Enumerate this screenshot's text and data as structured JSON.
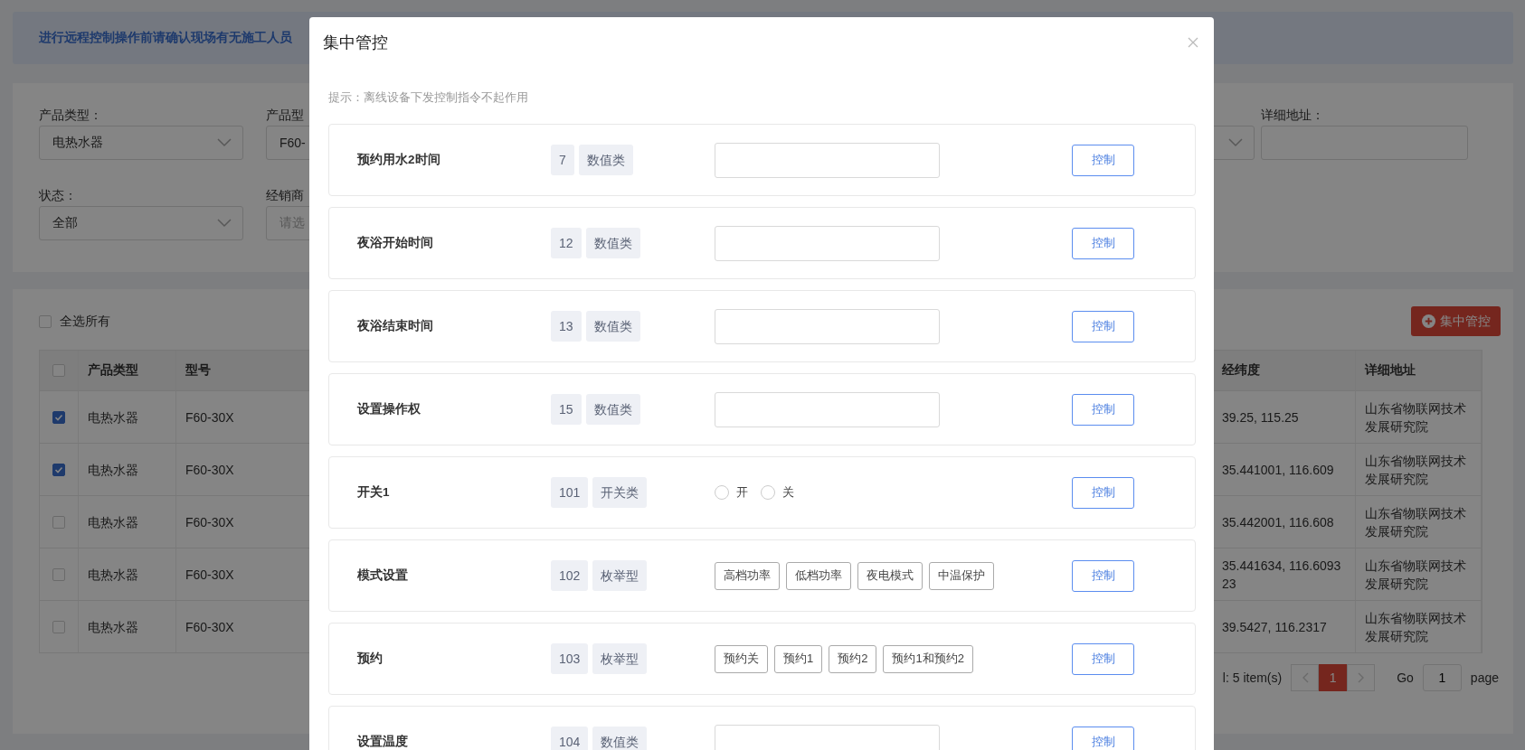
{
  "banner": {
    "text": "进行远程控制操作前请确认现场有无施工人员"
  },
  "filters": {
    "product_type": {
      "label": "产品类型：",
      "value": "电热水器"
    },
    "product_model": {
      "label": "产品型",
      "value": "F60-"
    },
    "address": {
      "label": "详细地址："
    },
    "status": {
      "label": "状态：",
      "value": "全部"
    },
    "dealer": {
      "label": "经销商",
      "placeholder": "请选"
    }
  },
  "table": {
    "select_all": {
      "label": "全选所有",
      "checked": false
    },
    "batch_button": "集中管控",
    "header_checked": false,
    "columns": [
      "产品类型",
      "型号",
      "经纬度",
      "详细地址"
    ],
    "rows": [
      {
        "checked": true,
        "type": "电热水器",
        "model": "F60-30X",
        "coords": "39.25, 115.25",
        "address": "山东省物联网技术发展研究院"
      },
      {
        "checked": true,
        "type": "电热水器",
        "model": "F60-30X",
        "coords": "35.441001, 116.609",
        "address": "山东省物联网技术发展研究院"
      },
      {
        "checked": false,
        "type": "电热水器",
        "model": "F60-30X",
        "coords": "35.442001, 116.608",
        "address": "山东省物联网技术发展研究院"
      },
      {
        "checked": false,
        "type": "电热水器",
        "model": "F60-30X",
        "coords": "35.441634, 116.609323",
        "address": "山东省物联网技术发展研究院"
      },
      {
        "checked": false,
        "type": "电热水器",
        "model": "F60-30X",
        "coords": "39.5427, 116.2317",
        "address": "山东省物联网技术发展研究院"
      }
    ]
  },
  "pagination": {
    "total": "l: 5 item(s)",
    "pages": [
      {
        "label": "1",
        "selected": true
      }
    ],
    "go_label": "Go",
    "go_value": "1",
    "page_label": "page"
  },
  "modal": {
    "title": "集中管控",
    "hint": "提示：离线设备下发控制指令不起作用",
    "controls": [
      {
        "kind": "number",
        "name": "预约用水2时间",
        "code": "7",
        "type": "数值类",
        "button": "控制"
      },
      {
        "kind": "number",
        "name": "夜浴开始时间",
        "code": "12",
        "type": "数值类",
        "button": "控制"
      },
      {
        "kind": "number",
        "name": "夜浴结束时间",
        "code": "13",
        "type": "数值类",
        "button": "控制"
      },
      {
        "kind": "number",
        "name": "设置操作权",
        "code": "15",
        "type": "数值类",
        "button": "控制"
      },
      {
        "kind": "switch",
        "name": "开关1",
        "code": "101",
        "type": "开关类",
        "button": "控制",
        "options": [
          {
            "label": "开",
            "selected": false
          },
          {
            "label": "关",
            "selected": false
          }
        ]
      },
      {
        "kind": "enum",
        "name": "模式设置",
        "code": "102",
        "type": "枚举型",
        "button": "控制",
        "options": [
          {
            "label": "高档功率",
            "selected": false
          },
          {
            "label": "低档功率",
            "selected": false
          },
          {
            "label": "夜电模式",
            "selected": false
          },
          {
            "label": "中温保护",
            "selected": false
          }
        ]
      },
      {
        "kind": "enum",
        "name": "预约",
        "code": "103",
        "type": "枚举型",
        "button": "控制",
        "options": [
          {
            "label": "预约关",
            "selected": false
          },
          {
            "label": "预约1",
            "selected": false
          },
          {
            "label": "预约2",
            "selected": false
          },
          {
            "label": "预约1和预约2",
            "selected": false
          }
        ]
      },
      {
        "kind": "number",
        "name": "设置温度",
        "code": "104",
        "type": "数值类",
        "button": "控制"
      }
    ]
  }
}
